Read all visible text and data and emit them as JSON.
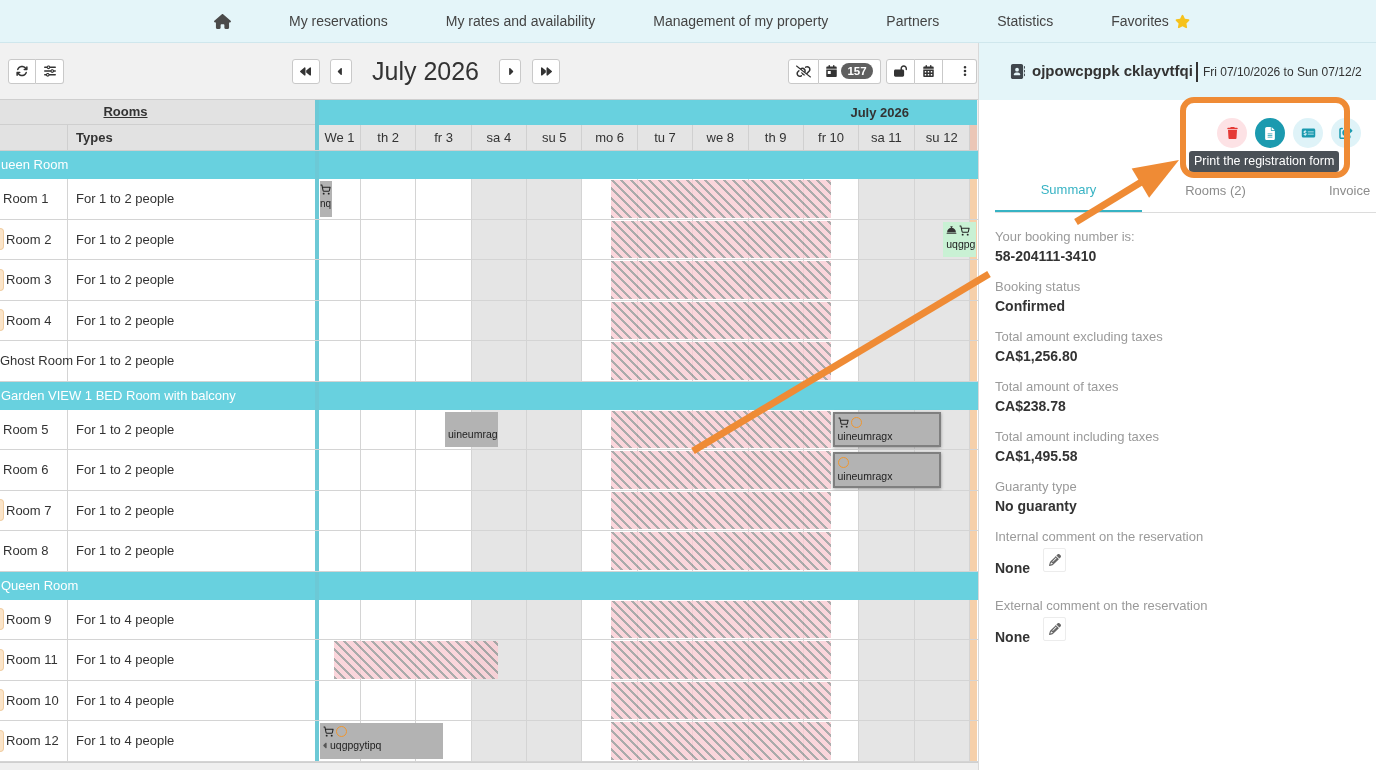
{
  "nav": {
    "items": [
      {
        "kind": "home"
      },
      {
        "kind": "link",
        "label": "My reservations"
      },
      {
        "kind": "link",
        "label": "My rates and availability"
      },
      {
        "kind": "link",
        "label": "Management of my property"
      },
      {
        "kind": "link",
        "label": "Partners"
      },
      {
        "kind": "link",
        "label": "Statistics"
      },
      {
        "kind": "favorites",
        "label": "Favorites"
      }
    ]
  },
  "toolbar": {
    "month": "July 2026",
    "count": "157"
  },
  "grid": {
    "rooms_header": "Rooms",
    "types_header": "Types",
    "month": "July 2026",
    "days": [
      {
        "label": "We 1",
        "weekend": false
      },
      {
        "label": "th 2",
        "weekend": false
      },
      {
        "label": "fr 3",
        "weekend": false
      },
      {
        "label": "sa 4",
        "weekend": true
      },
      {
        "label": "su 5",
        "weekend": true
      },
      {
        "label": "mo 6",
        "weekend": false
      },
      {
        "label": "tu 7",
        "weekend": false
      },
      {
        "label": "we 8",
        "weekend": false
      },
      {
        "label": "th 9",
        "weekend": false
      },
      {
        "label": "fr 10",
        "weekend": false
      },
      {
        "label": "sa 11",
        "weekend": true
      },
      {
        "label": "su 12",
        "weekend": true
      }
    ],
    "groups": [
      {
        "name": "ueen Room",
        "rooms": [
          {
            "name": "Room 1",
            "type": "For 1 to 2 people",
            "tag": false,
            "nights": [
              {
                "kind": "booking",
                "label": "nq",
                "color": "#b3b3b3",
                "icons": [
                  {
                    "kind": "cart"
                  }
                ],
                "selected": false,
                "left_arrow": false
              },
              {
                "kind": "free"
              },
              {
                "kind": "free"
              },
              {
                "kind": "free"
              },
              {
                "kind": "free"
              },
              {
                "kind": "free"
              },
              {
                "kind": "closed"
              },
              {
                "kind": "closed"
              },
              {
                "kind": "closed"
              },
              {
                "kind": "closed"
              },
              {
                "kind": "free"
              },
              {
                "kind": "free"
              },
              {
                "kind": "free"
              }
            ]
          },
          {
            "name": "Room 2",
            "type": "For 1 to 2 people",
            "tag": true,
            "nights": [
              {
                "kind": "free"
              },
              {
                "kind": "free"
              },
              {
                "kind": "free"
              },
              {
                "kind": "free"
              },
              {
                "kind": "free"
              },
              {
                "kind": "free"
              },
              {
                "kind": "closed"
              },
              {
                "kind": "closed"
              },
              {
                "kind": "closed"
              },
              {
                "kind": "closed"
              },
              {
                "kind": "free"
              },
              {
                "kind": "free"
              },
              {
                "kind": "booking",
                "label": "uqgpg",
                "color": "#c9f1d4",
                "icons": [
                  {
                    "kind": "bell"
                  },
                  {
                    "kind": "cart"
                  }
                ],
                "selected": false,
                "left_arrow": false
              }
            ]
          },
          {
            "name": "Room 3",
            "type": "For 1 to 2 people",
            "tag": true,
            "nights": [
              {
                "kind": "free"
              },
              {
                "kind": "free"
              },
              {
                "kind": "free"
              },
              {
                "kind": "free"
              },
              {
                "kind": "free"
              },
              {
                "kind": "free"
              },
              {
                "kind": "closed"
              },
              {
                "kind": "closed"
              },
              {
                "kind": "closed"
              },
              {
                "kind": "closed"
              },
              {
                "kind": "free"
              },
              {
                "kind": "free"
              },
              {
                "kind": "free"
              }
            ]
          },
          {
            "name": "Room 4",
            "type": "For 1 to 2 people",
            "tag": true,
            "nights": [
              {
                "kind": "free"
              },
              {
                "kind": "free"
              },
              {
                "kind": "free"
              },
              {
                "kind": "free"
              },
              {
                "kind": "free"
              },
              {
                "kind": "free"
              },
              {
                "kind": "closed"
              },
              {
                "kind": "closed"
              },
              {
                "kind": "closed"
              },
              {
                "kind": "closed"
              },
              {
                "kind": "free"
              },
              {
                "kind": "free"
              },
              {
                "kind": "free"
              }
            ]
          },
          {
            "name": "Ghost Room",
            "type": "For 1 to 2 people",
            "tag": false,
            "nights": [
              {
                "kind": "free"
              },
              {
                "kind": "free"
              },
              {
                "kind": "free"
              },
              {
                "kind": "free"
              },
              {
                "kind": "free"
              },
              {
                "kind": "free"
              },
              {
                "kind": "closed"
              },
              {
                "kind": "closed"
              },
              {
                "kind": "closed"
              },
              {
                "kind": "closed"
              },
              {
                "kind": "free"
              },
              {
                "kind": "free"
              },
              {
                "kind": "free"
              }
            ]
          }
        ]
      },
      {
        "name": "Garden VIEW 1 BED Room with balcony",
        "rooms": [
          {
            "name": "Room 5",
            "type": "For 1 to 2 people",
            "tag": false,
            "nights": [
              {
                "kind": "free"
              },
              {
                "kind": "free"
              },
              {
                "kind": "free"
              },
              {
                "kind": "booking",
                "label": "uineumrag",
                "color": "#b3b3b3",
                "selected": false,
                "left_arrow": false
              },
              {
                "kind": "free"
              },
              {
                "kind": "free"
              },
              {
                "kind": "closed"
              },
              {
                "kind": "closed"
              },
              {
                "kind": "closed"
              },
              {
                "kind": "closed"
              },
              {
                "kind": "booking",
                "label": "uineumragx",
                "color": "#b3b3b3",
                "icons": [
                  {
                    "kind": "cart"
                  },
                  {
                    "kind": "ring"
                  }
                ],
                "selected": true,
                "left_arrow": false
              },
              {
                "kind": "stay"
              },
              {
                "kind": "free"
              }
            ]
          },
          {
            "name": "Room 6",
            "type": "For 1 to 2 people",
            "tag": false,
            "nights": [
              {
                "kind": "free"
              },
              {
                "kind": "free"
              },
              {
                "kind": "free"
              },
              {
                "kind": "free"
              },
              {
                "kind": "free"
              },
              {
                "kind": "free"
              },
              {
                "kind": "closed"
              },
              {
                "kind": "closed"
              },
              {
                "kind": "closed"
              },
              {
                "kind": "closed"
              },
              {
                "kind": "booking",
                "label": "uineumragx",
                "color": "#b3b3b3",
                "icons": [
                  {
                    "kind": "ring"
                  }
                ],
                "selected": true,
                "left_arrow": false
              },
              {
                "kind": "stay"
              },
              {
                "kind": "free"
              }
            ]
          },
          {
            "name": "Room 7",
            "type": "For 1 to 2 people",
            "tag": true,
            "nights": [
              {
                "kind": "free"
              },
              {
                "kind": "free"
              },
              {
                "kind": "free"
              },
              {
                "kind": "free"
              },
              {
                "kind": "free"
              },
              {
                "kind": "free"
              },
              {
                "kind": "closed"
              },
              {
                "kind": "closed"
              },
              {
                "kind": "closed"
              },
              {
                "kind": "closed"
              },
              {
                "kind": "free"
              },
              {
                "kind": "free"
              },
              {
                "kind": "free"
              }
            ]
          },
          {
            "name": "Room 8",
            "type": "For 1 to 2 people",
            "tag": false,
            "nights": [
              {
                "kind": "free"
              },
              {
                "kind": "free"
              },
              {
                "kind": "free"
              },
              {
                "kind": "free"
              },
              {
                "kind": "free"
              },
              {
                "kind": "free"
              },
              {
                "kind": "closed"
              },
              {
                "kind": "closed"
              },
              {
                "kind": "closed"
              },
              {
                "kind": "closed"
              },
              {
                "kind": "free"
              },
              {
                "kind": "free"
              },
              {
                "kind": "free"
              }
            ]
          }
        ]
      },
      {
        "name": "Queen Room",
        "rooms": [
          {
            "name": "Room 9",
            "type": "For 1 to 4 people",
            "tag": true,
            "nights": [
              {
                "kind": "free"
              },
              {
                "kind": "free"
              },
              {
                "kind": "free"
              },
              {
                "kind": "free"
              },
              {
                "kind": "free"
              },
              {
                "kind": "free"
              },
              {
                "kind": "closed"
              },
              {
                "kind": "closed"
              },
              {
                "kind": "closed"
              },
              {
                "kind": "closed"
              },
              {
                "kind": "free"
              },
              {
                "kind": "free"
              },
              {
                "kind": "free"
              }
            ]
          },
          {
            "name": "Room 11",
            "type": "For 1 to 4 people",
            "tag": true,
            "nights": [
              {
                "kind": "free"
              },
              {
                "kind": "closed"
              },
              {
                "kind": "closed"
              },
              {
                "kind": "closed"
              },
              {
                "kind": "free"
              },
              {
                "kind": "free"
              },
              {
                "kind": "closed"
              },
              {
                "kind": "closed"
              },
              {
                "kind": "closed"
              },
              {
                "kind": "closed"
              },
              {
                "kind": "free"
              },
              {
                "kind": "free"
              },
              {
                "kind": "free"
              }
            ]
          },
          {
            "name": "Room 10",
            "type": "For 1 to 4 people",
            "tag": true,
            "nights": [
              {
                "kind": "free"
              },
              {
                "kind": "free"
              },
              {
                "kind": "free"
              },
              {
                "kind": "free"
              },
              {
                "kind": "free"
              },
              {
                "kind": "free"
              },
              {
                "kind": "closed"
              },
              {
                "kind": "closed"
              },
              {
                "kind": "closed"
              },
              {
                "kind": "closed"
              },
              {
                "kind": "free"
              },
              {
                "kind": "free"
              },
              {
                "kind": "free"
              }
            ]
          },
          {
            "name": "Room 12",
            "type": "For 1 to 4 people",
            "tag": true,
            "nights": [
              {
                "kind": "booking",
                "label": "uqgpgytipq",
                "color": "#b3b3b3",
                "icons": [
                  {
                    "kind": "cart"
                  },
                  {
                    "kind": "ring"
                  }
                ],
                "selected": false,
                "left_arrow": true
              },
              {
                "kind": "stay"
              },
              {
                "kind": "stay"
              },
              {
                "kind": "free"
              },
              {
                "kind": "free"
              },
              {
                "kind": "free"
              },
              {
                "kind": "closed"
              },
              {
                "kind": "closed"
              },
              {
                "kind": "closed"
              },
              {
                "kind": "closed"
              },
              {
                "kind": "free"
              },
              {
                "kind": "free"
              },
              {
                "kind": "free"
              }
            ]
          }
        ]
      }
    ]
  },
  "reservation": {
    "guest": "ojpowcpgpk cklayvtfqi",
    "dates": "Fri 07/10/2026 to Sun 07/12/2",
    "actions": [
      {
        "kind": "delete",
        "active": false
      },
      {
        "kind": "print",
        "active": true,
        "tooltip": "Print the registration form"
      },
      {
        "kind": "payment",
        "active": false
      },
      {
        "kind": "share",
        "active": false
      }
    ],
    "tabs": [
      {
        "label": "Summary",
        "selected": true
      },
      {
        "label": "Rooms (2)",
        "selected": false
      },
      {
        "label": "Invoice",
        "selected": false
      }
    ],
    "fields": [
      {
        "label": "Your booking number is:",
        "value": "58-204111-3410",
        "editable": false
      },
      {
        "label": "Booking status",
        "value": "Confirmed",
        "editable": false
      },
      {
        "label": "Total amount excluding taxes",
        "value": "CA$1,256.80",
        "editable": false
      },
      {
        "label": "Total amount of taxes",
        "value": "CA$238.78",
        "editable": false
      },
      {
        "label": "Total amount including taxes",
        "value": "CA$1,495.58",
        "editable": false
      },
      {
        "label": "Guaranty type",
        "value": "No guaranty",
        "editable": false
      },
      {
        "label": "Internal comment on the reservation",
        "value": "None",
        "editable": true
      },
      {
        "label": "External comment on the reservation",
        "value": "None",
        "editable": true
      }
    ]
  }
}
